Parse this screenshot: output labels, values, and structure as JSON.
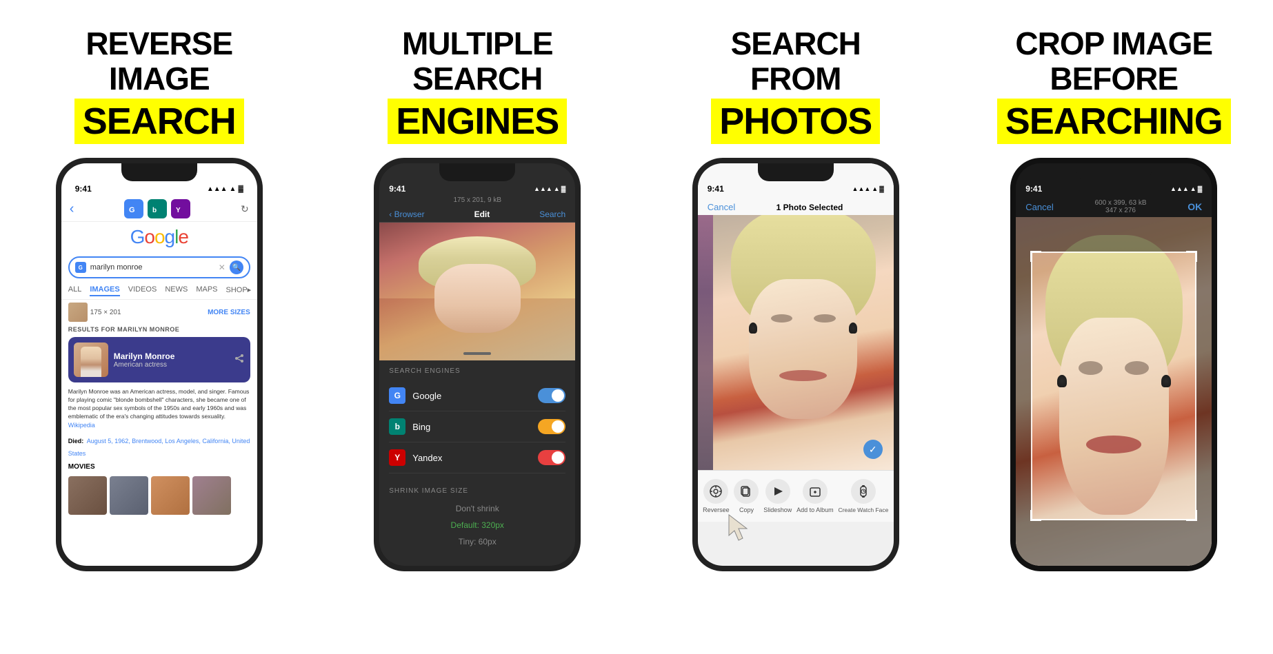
{
  "panels": [
    {
      "id": "panel1",
      "title_line1": "REVERSE",
      "title_line2": "IMAGE",
      "title_highlight": "SEARCH",
      "phone": {
        "time": "9:41",
        "status_icons": "▲ ▲ ▓",
        "back_arrow": "‹",
        "engine_icons": [
          "G",
          "b",
          "Y"
        ],
        "refresh_icon": "↻",
        "google_logo": "Google",
        "search_placeholder": "marilyn monroe",
        "tabs": [
          "ALL",
          "IMAGES",
          "VIDEOS",
          "NEWS",
          "MAPS",
          "SHOP"
        ],
        "active_tab": "IMAGES",
        "image_info": "175 × 201",
        "more_sizes": "MORE SIZES",
        "results_label": "RESULTS FOR MARILYN MONROE",
        "card_name": "Marilyn Monroe",
        "card_subtitle": "American actress",
        "description": "Marilyn Monroe was an American actress, model, and singer. Famous for playing comic \"blonde bombshell\" characters, she became one of the most popular sex symbols of the 1950s and early 1960s and was emblematic of the era's changing attitudes towards sexuality.",
        "wiki_link": "Wikipedia",
        "died_label": "Died:",
        "died_value": "August 5, 1962, Brentwood, Los Angeles, California, United States",
        "movies_label": "MOVIES"
      }
    },
    {
      "id": "panel2",
      "title_line1": "MULTIPLE",
      "title_line2": "SEARCH",
      "title_highlight": "ENGINES",
      "phone": {
        "time": "9:41",
        "image_dimensions": "175 x 201, 9 kB",
        "back_label": "‹ Browser",
        "edit_label": "Edit",
        "search_label": "Search",
        "section_label": "SEARCH ENGINES",
        "engines": [
          {
            "icon": "G",
            "name": "Google",
            "toggle": "blue"
          },
          {
            "icon": "b",
            "name": "Bing",
            "toggle": "orange"
          },
          {
            "icon": "Y",
            "name": "Yandex",
            "toggle": "red"
          }
        ],
        "shrink_label": "SHRINK IMAGE SIZE",
        "shrink_options": [
          "Don't shrink",
          "Default: 320px",
          "Tiny: 60px"
        ]
      }
    },
    {
      "id": "panel3",
      "title_line1": "SEARCH",
      "title_line2": "FROM",
      "title_highlight": "PHOTOS",
      "phone": {
        "time": "9:41",
        "cancel_label": "Cancel",
        "header_title": "1 Photo Selected",
        "actions": [
          {
            "icon": "⋯",
            "label": "Reversee"
          },
          {
            "icon": "⧉",
            "label": "Copy"
          },
          {
            "icon": "▶",
            "label": "Slideshow"
          },
          {
            "icon": "＋",
            "label": "Add to Album"
          },
          {
            "icon": "◷",
            "label": "Create Watch Face"
          }
        ]
      }
    },
    {
      "id": "panel4",
      "title_line1": "CROP IMAGE",
      "title_line2": "BEFORE",
      "title_highlight": "SEARCHING",
      "phone": {
        "time": "9:41",
        "cancel_label": "Cancel",
        "dimensions": "600 x 399, 63 kB",
        "sub_dimensions": "347 x 276",
        "ok_label": "OK"
      }
    }
  ]
}
